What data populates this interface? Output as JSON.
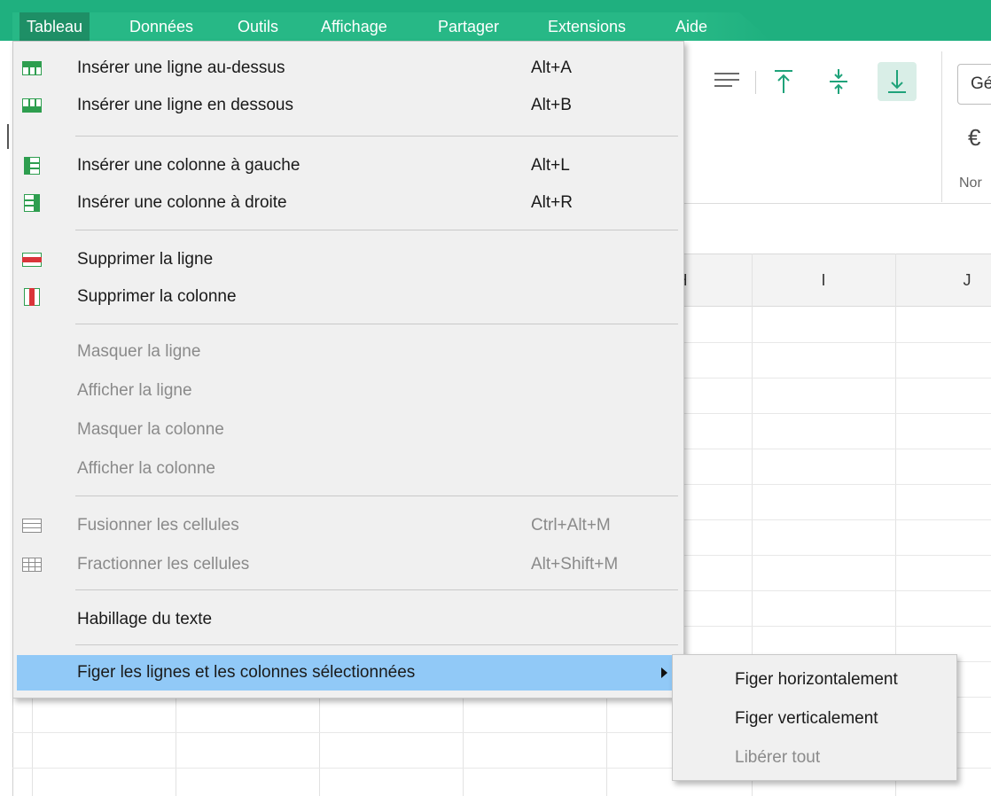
{
  "menubar": {
    "items": [
      "Tableau",
      "Données",
      "Outils",
      "Affichage",
      "Partager",
      "Extensions",
      "Aide"
    ],
    "active_index": 0,
    "accent": "#1fb07f"
  },
  "toolbar": {
    "format_value": "Gé",
    "currency_symbol": "€",
    "group_label": "Nor"
  },
  "sheet": {
    "columns": [
      "H",
      "I",
      "J"
    ]
  },
  "dropdown": {
    "items": [
      {
        "label": "Insérer une ligne au-dessus",
        "shortcut": "Alt+A",
        "icon": "insert-row-above-icon",
        "enabled": true
      },
      {
        "label": "Insérer une ligne en dessous",
        "shortcut": "Alt+B",
        "icon": "insert-row-below-icon",
        "enabled": true
      },
      {
        "label": "Insérer une colonne à gauche",
        "shortcut": "Alt+L",
        "icon": "insert-column-left-icon",
        "enabled": true
      },
      {
        "label": "Insérer une colonne à droite",
        "shortcut": "Alt+R",
        "icon": "insert-column-right-icon",
        "enabled": true
      },
      {
        "label": "Supprimer la ligne",
        "shortcut": "",
        "icon": "delete-row-icon",
        "enabled": true
      },
      {
        "label": "Supprimer la colonne",
        "shortcut": "",
        "icon": "delete-column-icon",
        "enabled": true
      },
      {
        "label": "Masquer la ligne",
        "shortcut": "",
        "icon": "",
        "enabled": false
      },
      {
        "label": "Afficher la ligne",
        "shortcut": "",
        "icon": "",
        "enabled": false
      },
      {
        "label": "Masquer la colonne",
        "shortcut": "",
        "icon": "",
        "enabled": false
      },
      {
        "label": "Afficher la colonne",
        "shortcut": "",
        "icon": "",
        "enabled": false
      },
      {
        "label": "Fusionner les cellules",
        "shortcut": "Ctrl+Alt+M",
        "icon": "merge-cells-icon",
        "enabled": false
      },
      {
        "label": "Fractionner les cellules",
        "shortcut": "Alt+Shift+M",
        "icon": "split-cells-icon",
        "enabled": false
      },
      {
        "label": "Habillage du texte",
        "shortcut": "",
        "icon": "",
        "enabled": true
      },
      {
        "label": "Figer les lignes et les colonnes sélectionnées",
        "shortcut": "",
        "icon": "",
        "enabled": true,
        "has_submenu": true,
        "highlighted": true
      }
    ]
  },
  "submenu": {
    "items": [
      {
        "label": "Figer horizontalement",
        "enabled": true
      },
      {
        "label": "Figer verticalement",
        "enabled": true
      },
      {
        "label": "Libérer tout",
        "enabled": false
      }
    ]
  },
  "colors": {
    "highlight": "#91c9f7",
    "menu_bg": "#f0f0f0",
    "disabled_text": "#8a8a8a"
  }
}
